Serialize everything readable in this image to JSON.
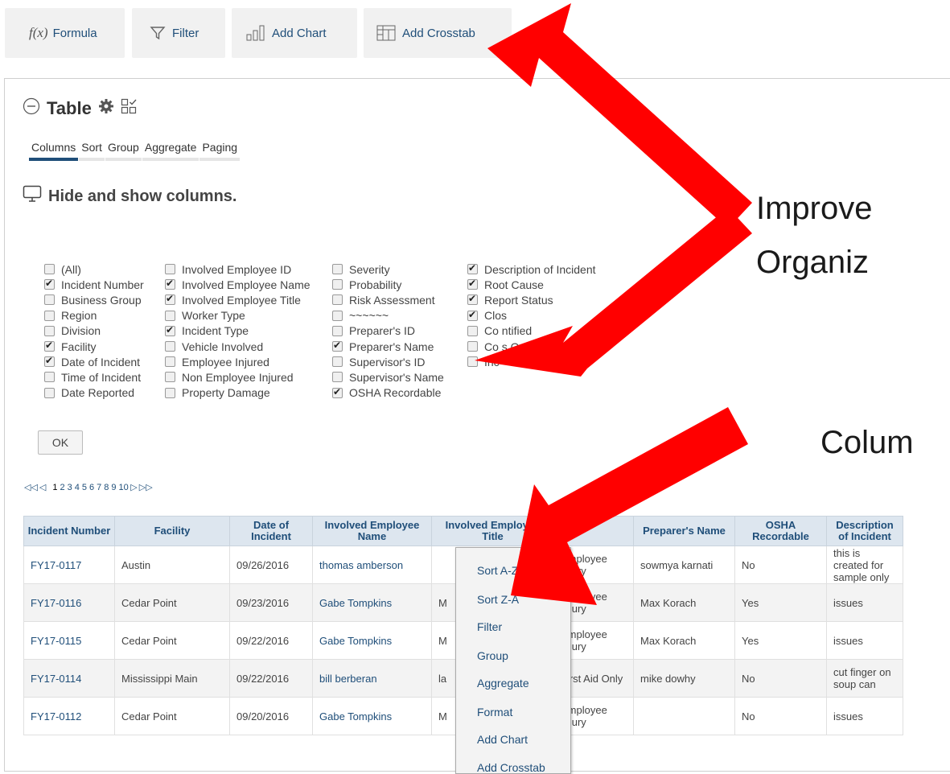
{
  "toolbar": {
    "formula_symbol": "f(x)",
    "formula": "Formula",
    "filter": "Filter",
    "add_chart": "Add Chart",
    "add_crosstab": "Add Crosstab"
  },
  "panel": {
    "title": "Table",
    "tabs": [
      "Columns",
      "Sort",
      "Group",
      "Aggregate",
      "Paging"
    ],
    "active_tab": "Columns",
    "heading": "Hide and show columns.",
    "columns": [
      [
        {
          "label": "(All)",
          "checked": false
        },
        {
          "label": "Incident Number",
          "checked": true
        },
        {
          "label": "Business Group",
          "checked": false
        },
        {
          "label": "Region",
          "checked": false
        },
        {
          "label": "Division",
          "checked": false
        },
        {
          "label": "Facility",
          "checked": true
        },
        {
          "label": "Date of Incident",
          "checked": true
        },
        {
          "label": "Time of Incident",
          "checked": false
        },
        {
          "label": "Date Reported",
          "checked": false
        }
      ],
      [
        {
          "label": "Involved Employee ID",
          "checked": false
        },
        {
          "label": "Involved Employee Name",
          "checked": true
        },
        {
          "label": "Involved Employee Title",
          "checked": true
        },
        {
          "label": "Worker Type",
          "checked": false
        },
        {
          "label": "Incident Type",
          "checked": true
        },
        {
          "label": "Vehicle Involved",
          "checked": false
        },
        {
          "label": "Employee Injured",
          "checked": false
        },
        {
          "label": "Non Employee Injured",
          "checked": false
        },
        {
          "label": "Property Damage",
          "checked": false
        }
      ],
      [
        {
          "label": "Severity",
          "checked": false
        },
        {
          "label": "Probability",
          "checked": false
        },
        {
          "label": "Risk Assessment",
          "checked": false
        },
        {
          "label": "~~~~~~",
          "checked": false
        },
        {
          "label": "Preparer's ID",
          "checked": false
        },
        {
          "label": "Preparer's Name",
          "checked": true
        },
        {
          "label": "Supervisor's ID",
          "checked": false
        },
        {
          "label": "Supervisor's Name",
          "checked": false
        },
        {
          "label": "OSHA Recordable",
          "checked": true
        }
      ],
      [
        {
          "label": "Description of Incident",
          "checked": true
        },
        {
          "label": "Root Cause",
          "checked": true
        },
        {
          "label": "Report Status",
          "checked": true
        },
        {
          "label": "Clos",
          "checked": true
        },
        {
          "label": "Co        ntified",
          "checked": false
        },
        {
          "label": "Co          s Open",
          "checked": false
        },
        {
          "label": "Inc",
          "checked": false
        }
      ]
    ],
    "ok": "OK"
  },
  "pager": {
    "first": "◁◁",
    "prev": "◁",
    "pages": [
      "1",
      "2",
      "3",
      "4",
      "5",
      "6",
      "7",
      "8",
      "9",
      "10"
    ],
    "current": "1",
    "next": "▷",
    "last": "▷▷"
  },
  "table": {
    "headers": [
      "Incident Number",
      "Facility",
      "Date of Incident",
      "Involved Employee Name",
      "Involved Employee Title",
      "",
      "Preparer's Name",
      "OSHA Recordable",
      "Description of Incident"
    ],
    "rows": [
      [
        "FY17-0117",
        "Austin",
        "09/26/2016",
        "thomas amberson",
        "",
        "Employee Injury",
        "sowmya karnati",
        "No",
        "this is created for sample only"
      ],
      [
        "FY17-0116",
        "Cedar Point",
        "09/23/2016",
        "Gabe Tompkins",
        "M",
        "Employee Injury",
        "Max Korach",
        "Yes",
        "issues"
      ],
      [
        "FY17-0115",
        "Cedar Point",
        "09/22/2016",
        "Gabe Tompkins",
        "M",
        "Employee Injury",
        "Max Korach",
        "Yes",
        "issues"
      ],
      [
        "FY17-0114",
        "Mississippi Main",
        "09/22/2016",
        "bill berberan",
        "la",
        "First Aid Only",
        "mike dowhy",
        "No",
        "cut finger on soup can"
      ],
      [
        "FY17-0112",
        "Cedar Point",
        "09/20/2016",
        "Gabe Tompkins",
        "M",
        "Employee Injury",
        "",
        "No",
        "issues"
      ]
    ]
  },
  "context_menu": {
    "items": [
      "Sort A-Z",
      "Sort Z-A",
      "Filter",
      "Group",
      "Aggregate",
      "Format",
      "Add Chart",
      "Add Crosstab"
    ]
  },
  "annotations": {
    "line1": "Improve",
    "line2": "Organiz",
    "line3": "Colum"
  },
  "colors": {
    "accent": "#1f4e79",
    "arrow": "#ff0000",
    "header_bg": "#dde6ef"
  }
}
